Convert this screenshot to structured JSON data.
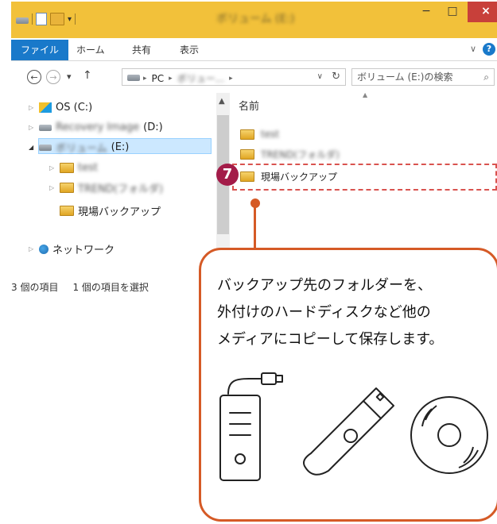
{
  "window": {
    "title": "ボリューム (E:)",
    "minimize": "−",
    "maximize": "□",
    "close": "×"
  },
  "ribbon": {
    "tabs": [
      {
        "label": "ファイル"
      },
      {
        "label": "ホーム"
      },
      {
        "label": "共有"
      },
      {
        "label": "表示"
      }
    ],
    "chevron": "∨",
    "help": "?"
  },
  "nav": {
    "back": "←",
    "forward": "→",
    "recent": "▾",
    "up": "↑",
    "path": [
      "PC",
      "ボリュー...",
      ""
    ],
    "sep": "▸",
    "dropdown": "∨",
    "refresh": "↻",
    "search_placeholder": "ボリューム (E:)の検索",
    "search_icon": "⌕"
  },
  "tree": {
    "os": "OS (C:)",
    "recovery_blur": "Recovery Image",
    "recovery_suffix": "(D:)",
    "volume_blur": "ボリューム",
    "volume_suffix": "(E:)",
    "sub1": "test",
    "sub2": "TREND(フォルダ)",
    "genba": "現場バックアップ",
    "network": "ネットワーク"
  },
  "status": {
    "items": "3 個の項目",
    "selected": "1 個の項目を選択"
  },
  "content": {
    "column_name": "名前",
    "rows": [
      {
        "name": "test",
        "blurred": true
      },
      {
        "name": "TREND(フォルダ)",
        "blurred": true
      },
      {
        "name": "現場バックアップ",
        "blurred": false
      }
    ]
  },
  "annotation": {
    "step": "7",
    "lines": [
      "バックアップ先のフォルダーを、",
      "外付けのハードディスクなど他の",
      "メディアにコピーして保存します。"
    ],
    "icons": [
      "external-hdd-icon",
      "usb-memory-icon",
      "cd-disc-icon"
    ],
    "accent_color": "#d55a26",
    "badge_color": "#a31c49"
  }
}
